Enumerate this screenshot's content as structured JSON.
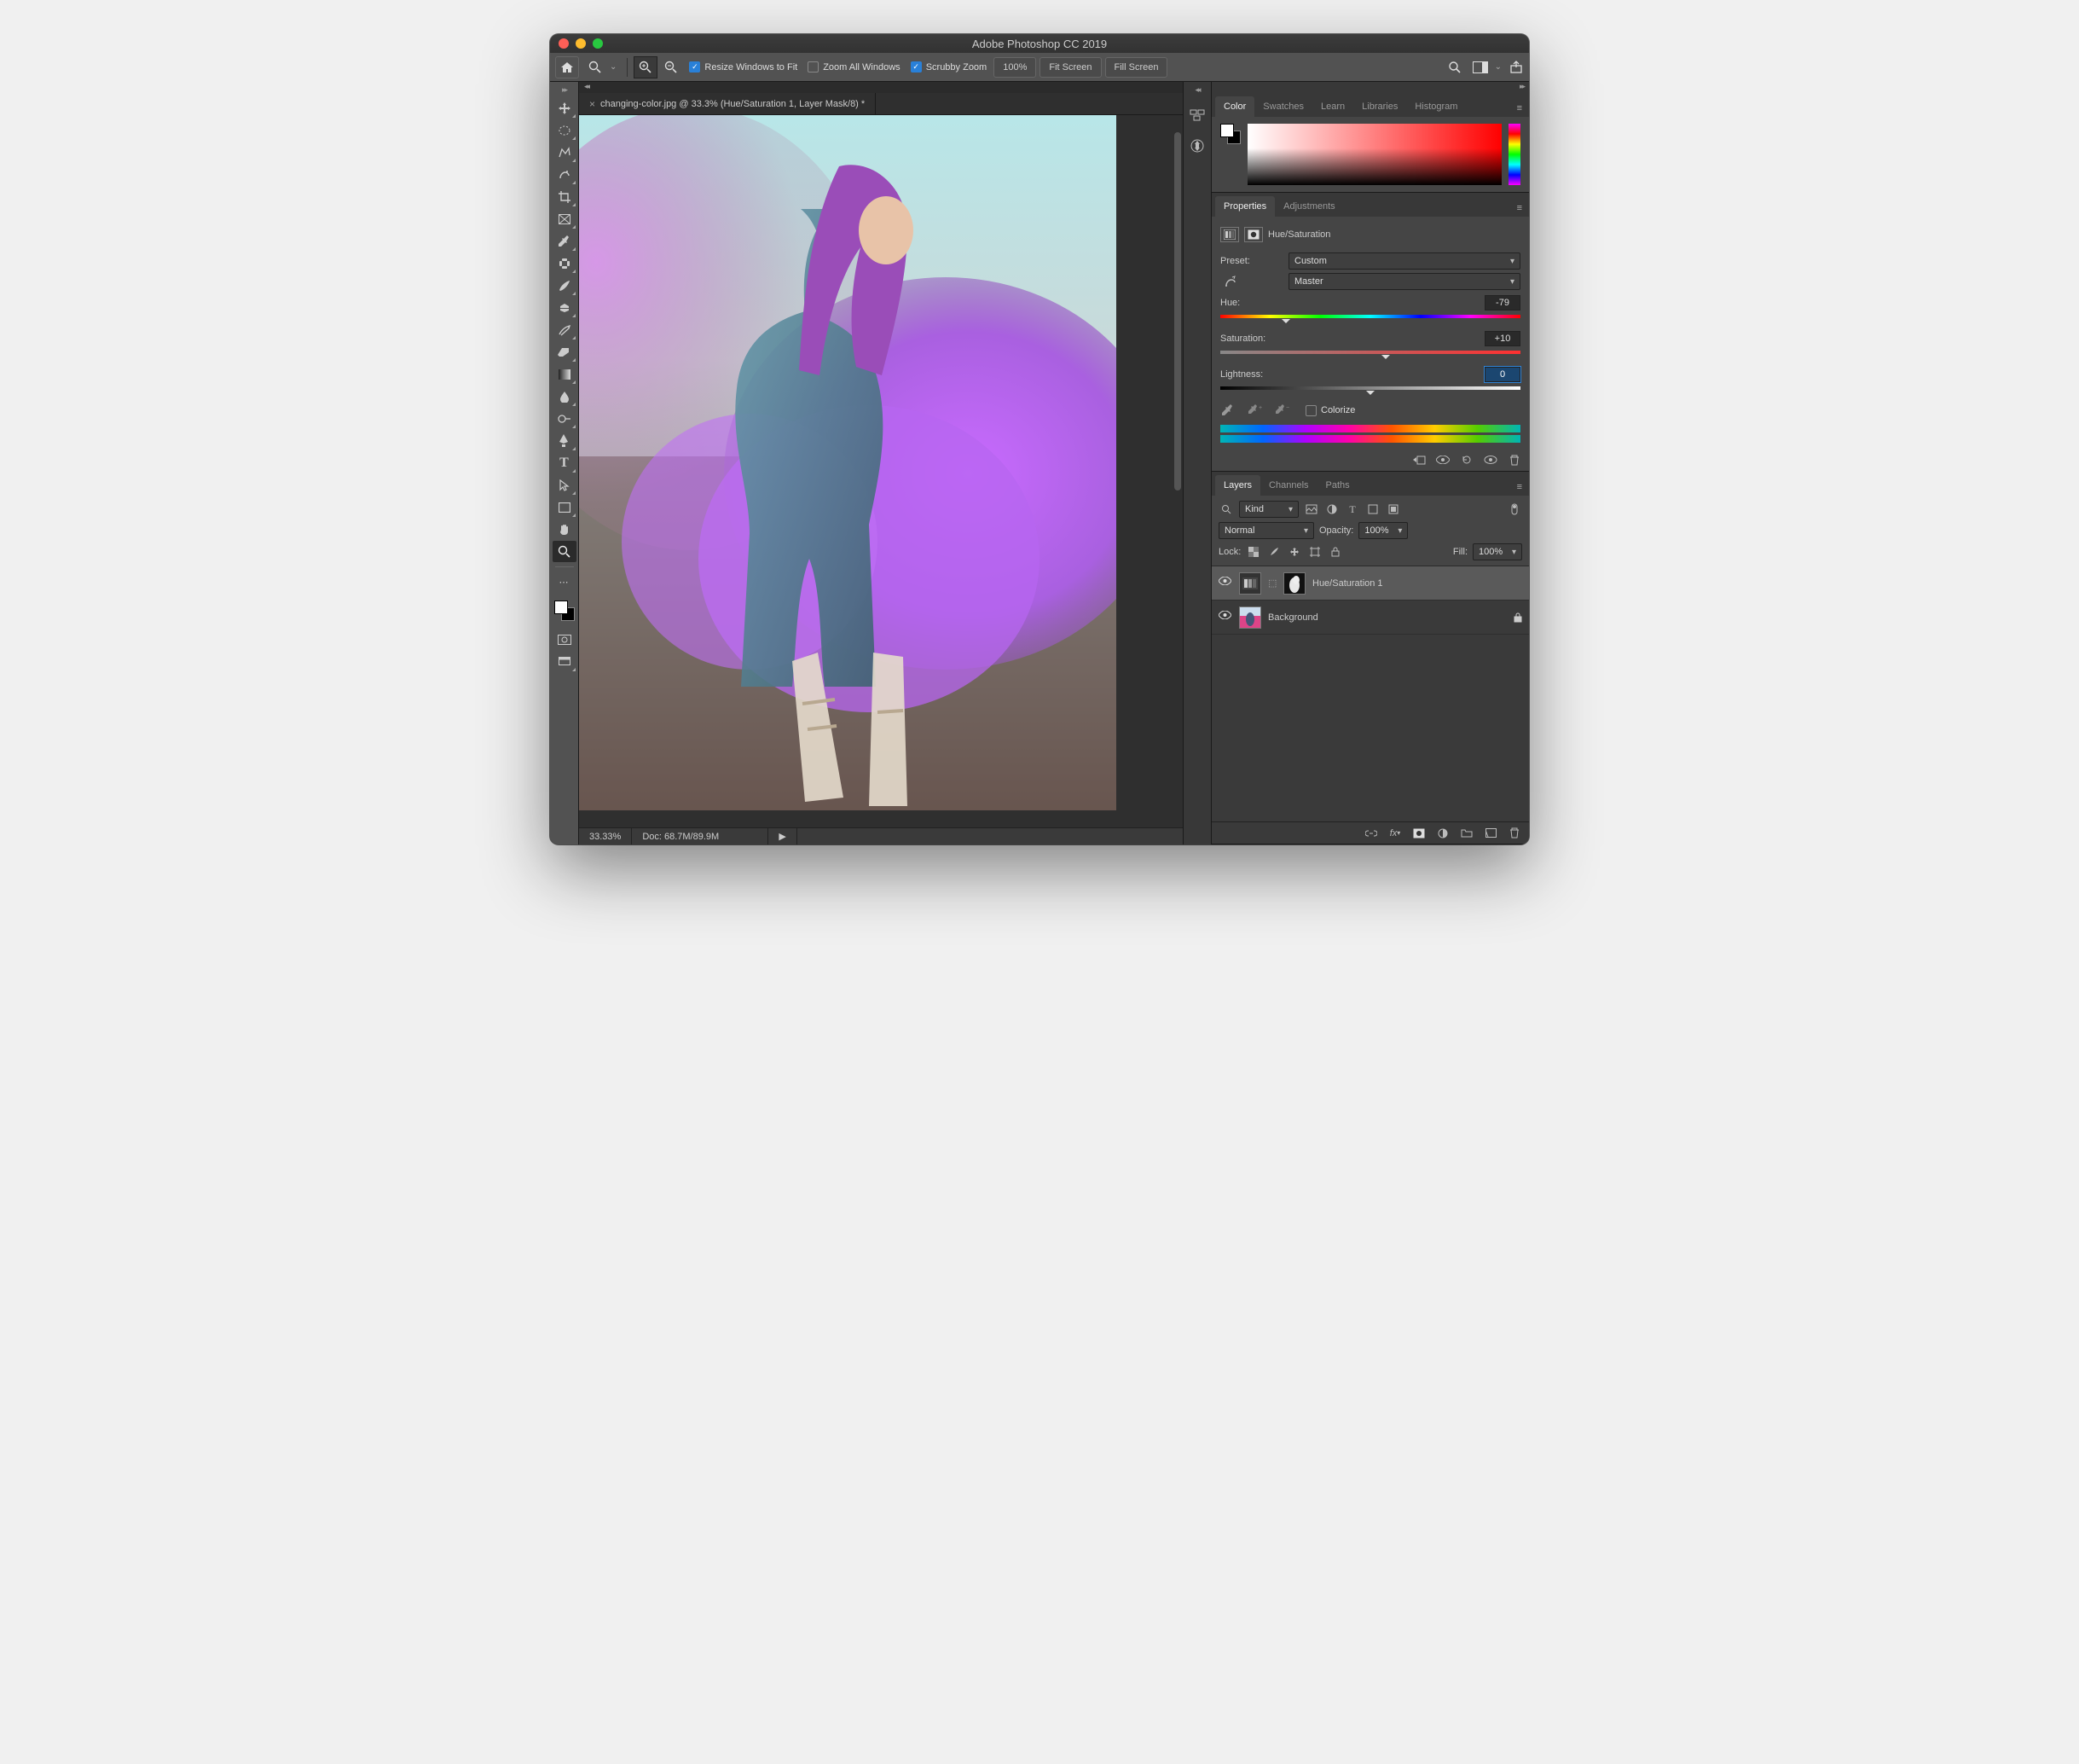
{
  "window": {
    "title": "Adobe Photoshop CC 2019"
  },
  "optionsBar": {
    "resizeWindows": "Resize Windows to Fit",
    "zoomAll": "Zoom All Windows",
    "scrubby": "Scrubby Zoom",
    "zoomPct": "100%",
    "fitScreen": "Fit Screen",
    "fillScreen": "Fill Screen"
  },
  "document": {
    "tab": "changing-color.jpg @ 33.3% (Hue/Saturation 1, Layer Mask/8) *",
    "zoom": "33.33%",
    "docInfo": "Doc: 68.7M/89.9M"
  },
  "colorTabs": [
    "Color",
    "Swatches",
    "Learn",
    "Libraries",
    "Histogram"
  ],
  "propTabs": [
    "Properties",
    "Adjustments"
  ],
  "hueSat": {
    "title": "Hue/Saturation",
    "presetLabel": "Preset:",
    "preset": "Custom",
    "channel": "Master",
    "hueLabel": "Hue:",
    "hue": "-79",
    "satLabel": "Saturation:",
    "sat": "+10",
    "ligLabel": "Lightness:",
    "lig": "0",
    "colorize": "Colorize"
  },
  "layersTabs": [
    "Layers",
    "Channels",
    "Paths"
  ],
  "layers": {
    "filterKind": "Kind",
    "blend": "Normal",
    "opacityLabel": "Opacity:",
    "opacity": "100%",
    "lockLabel": "Lock:",
    "fillLabel": "Fill:",
    "fill": "100%",
    "items": [
      {
        "name": "Hue/Saturation 1"
      },
      {
        "name": "Background"
      }
    ]
  }
}
